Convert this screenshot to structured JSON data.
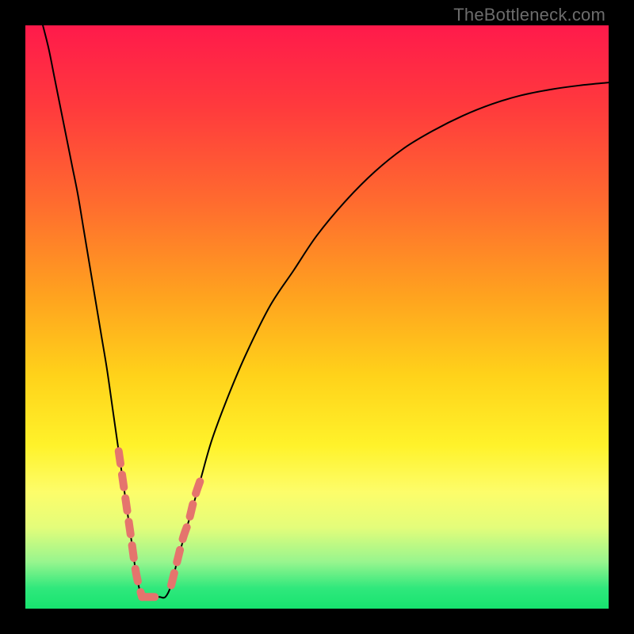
{
  "watermark": "TheBottleneck.com",
  "chart_data": {
    "type": "line",
    "title": "",
    "xlabel": "",
    "ylabel": "",
    "xlim": [
      0,
      100
    ],
    "ylim": [
      0,
      100
    ],
    "gradient_stops": [
      {
        "offset": 0.0,
        "color": "#ff1a4b"
      },
      {
        "offset": 0.14,
        "color": "#ff3a3d"
      },
      {
        "offset": 0.3,
        "color": "#ff6a2f"
      },
      {
        "offset": 0.46,
        "color": "#ffa11f"
      },
      {
        "offset": 0.6,
        "color": "#ffd21a"
      },
      {
        "offset": 0.72,
        "color": "#fff22a"
      },
      {
        "offset": 0.8,
        "color": "#fdfd6a"
      },
      {
        "offset": 0.86,
        "color": "#e4fd7a"
      },
      {
        "offset": 0.92,
        "color": "#97f58e"
      },
      {
        "offset": 0.965,
        "color": "#2fe87c"
      },
      {
        "offset": 1.0,
        "color": "#17e46f"
      }
    ],
    "series": [
      {
        "name": "bottleneck-curve",
        "color": "#000000",
        "width": 2.0,
        "x": [
          3,
          4,
          5,
          6,
          7,
          8,
          9,
          10,
          11,
          12,
          13,
          14,
          15,
          16,
          17,
          18,
          19,
          20,
          21,
          22,
          23,
          24,
          25,
          26,
          28,
          30,
          32,
          35,
          38,
          42,
          46,
          50,
          55,
          60,
          65,
          70,
          75,
          80,
          85,
          90,
          95,
          100
        ],
        "y": [
          100,
          96,
          91,
          86,
          81,
          76,
          71,
          65,
          59,
          53,
          47,
          41,
          34,
          27,
          20,
          13,
          6,
          2,
          2,
          2,
          2,
          2,
          4,
          8,
          15,
          22,
          29,
          37,
          44,
          52,
          58,
          64,
          70,
          75,
          79,
          82,
          84.5,
          86.5,
          88,
          89,
          89.7,
          90.2
        ]
      },
      {
        "name": "dotted-left-segment",
        "color": "#e5746d",
        "style": "dashed",
        "width": 10,
        "x": [
          16,
          17,
          18,
          19,
          20
        ],
        "y": [
          27,
          20,
          13,
          6,
          2
        ]
      },
      {
        "name": "dotted-bottom-segment",
        "color": "#e5746d",
        "style": "dashed",
        "width": 10,
        "x": [
          20,
          21,
          22,
          23,
          24
        ],
        "y": [
          2,
          2,
          2,
          2,
          2
        ]
      },
      {
        "name": "dotted-right-segment",
        "color": "#e5746d",
        "style": "dashed",
        "width": 10,
        "x": [
          25,
          26,
          27,
          28,
          29,
          30
        ],
        "y": [
          4,
          8,
          12,
          15,
          19,
          22
        ]
      }
    ]
  }
}
